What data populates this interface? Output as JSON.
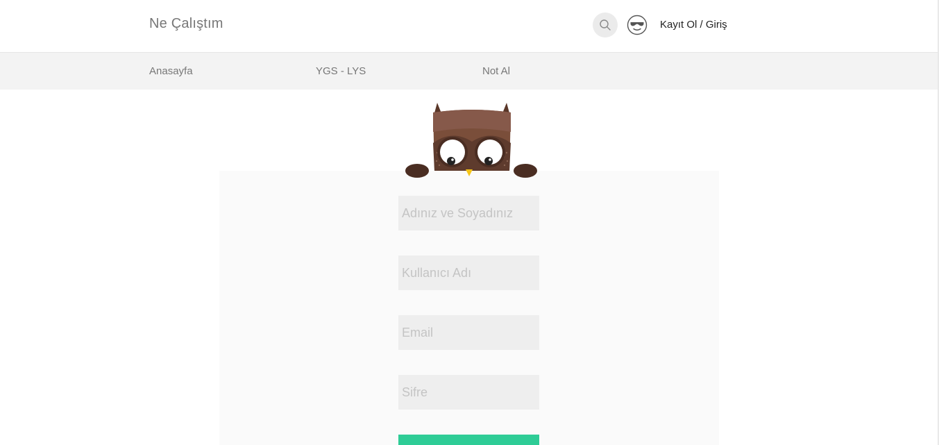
{
  "header": {
    "brand": "Ne Çalıştım",
    "auth_link": "Kayıt Ol / Giriş"
  },
  "nav": {
    "items": [
      {
        "label": "Anasayfa"
      },
      {
        "label": "YGS - LYS"
      },
      {
        "label": "Not Al"
      }
    ]
  },
  "form": {
    "fields": [
      {
        "placeholder": "Adınız ve Soyadınız",
        "value": ""
      },
      {
        "placeholder": "Kullanıcı Adı",
        "value": ""
      },
      {
        "placeholder": "Email",
        "value": ""
      },
      {
        "placeholder": "Sifre",
        "value": ""
      }
    ],
    "submit_label": ""
  },
  "icons": {
    "search": "search-icon",
    "avatar": "sunglasses-face-icon",
    "mascot": "owl-mascot"
  },
  "colors": {
    "accent": "#2ecc96",
    "owl_brown": "#7a4e3a",
    "nav_bg": "#f3f3f3"
  }
}
